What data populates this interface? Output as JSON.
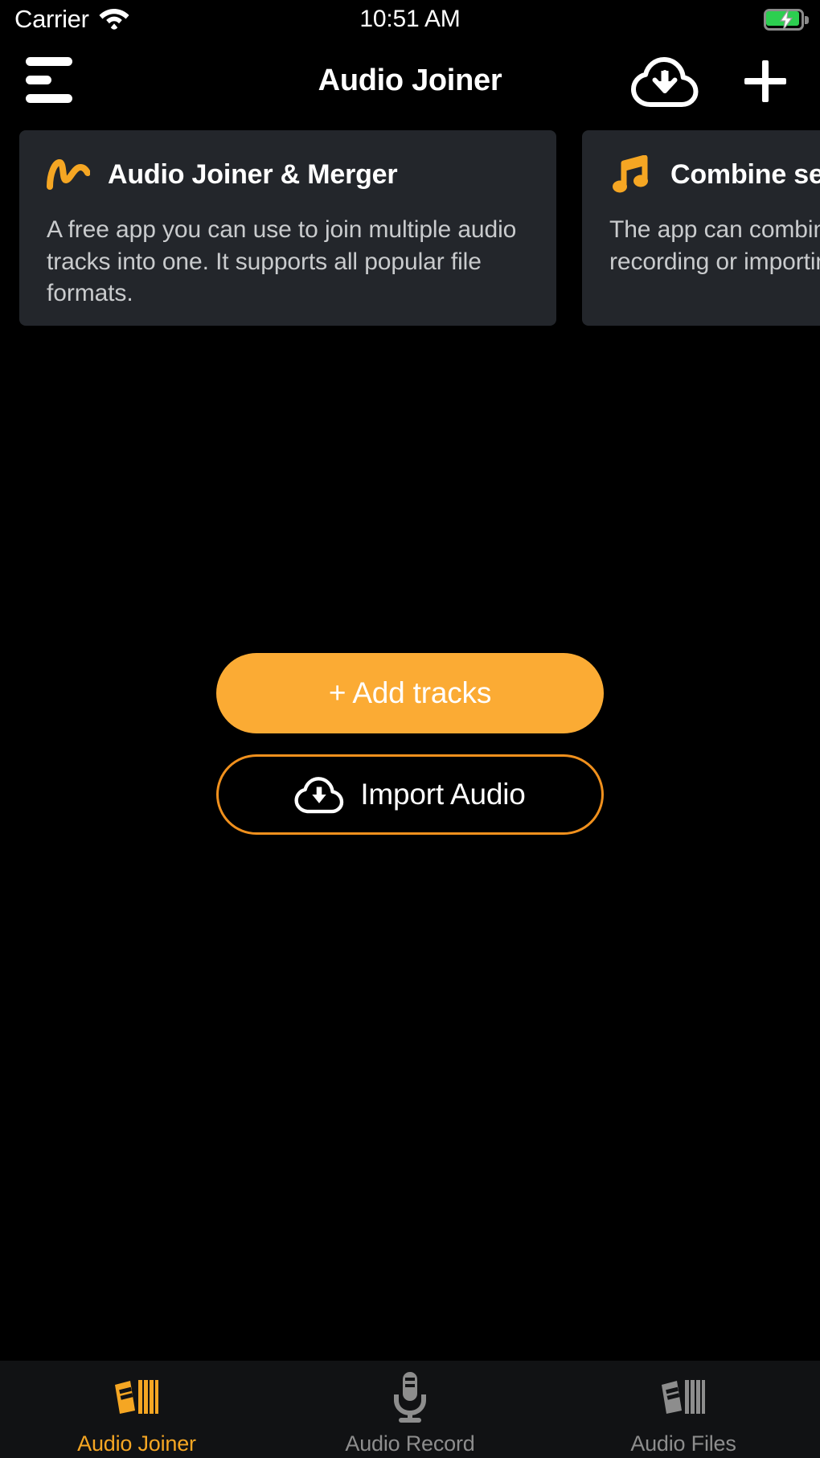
{
  "status_bar": {
    "carrier": "Carrier",
    "wifi_icon": "wifi-icon",
    "time": "10:51 AM",
    "battery_icon": "battery-charging-icon",
    "battery_color": "#2ccf50"
  },
  "nav_bar": {
    "menu_icon": "hamburger-menu-icon",
    "title": "Audio Joiner",
    "import_icon": "cloud-download-icon",
    "add_icon": "plus-icon"
  },
  "cards": [
    {
      "icon": "waveform-squiggle-icon",
      "icon_color": "#f5a623",
      "title": "Audio Joiner & Merger",
      "description": "A free app you can use to join multiple audio tracks into one. It supports all popular file formats."
    },
    {
      "icon": "music-note-icon",
      "icon_color": "#f5a623",
      "title": "Combine several audio files",
      "description": "The app can combine audio files after recording or importing them."
    }
  ],
  "actions": {
    "add_tracks_label": "+ Add tracks",
    "add_tracks_color": "#fbab34",
    "import_audio_label": "Import Audio",
    "import_audio_icon": "cloud-download-icon",
    "import_audio_border_color": "#f0901d"
  },
  "tab_bar": {
    "active_color": "#f5a623",
    "inactive_color": "#8d8d8d",
    "tabs": [
      {
        "label": "Audio Joiner",
        "icon": "audio-books-shelf-icon",
        "active": true
      },
      {
        "label": "Audio Record",
        "icon": "microphone-icon",
        "active": false
      },
      {
        "label": "Audio Files",
        "icon": "audio-books-shelf-icon",
        "active": false
      }
    ]
  }
}
